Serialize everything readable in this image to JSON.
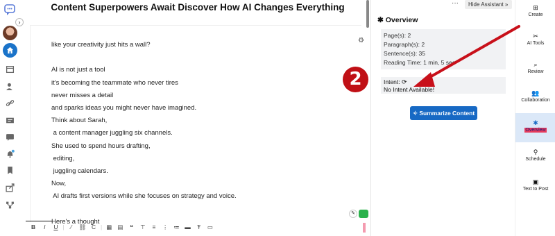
{
  "document": {
    "title": "Content Superpowers Await Discover How AI Changes Everything",
    "lines": [
      "like your creativity just hits a wall?",
      "",
      "AI is not just a tool",
      "it's becoming the teammate who never tires",
      "never misses a detail",
      "and sparks ideas you might never have imagined.",
      "Think about Sarah,",
      " a content manager juggling six channels.",
      "She used to spend hours drafting,",
      " editing,",
      " juggling calendars.",
      "Now,",
      " AI drafts first versions while she focuses on strategy and voice.",
      "",
      "Here's a thought"
    ]
  },
  "toolbar": {
    "items": [
      "B",
      "I",
      "U",
      "|",
      "⁄",
      "⛓",
      "C",
      "|",
      "▦",
      "▤",
      "❝",
      "⊤",
      "≡",
      "⋮",
      "≔",
      "▬",
      "Ŧ",
      "▭"
    ]
  },
  "assistant": {
    "more": "···",
    "hide_label": "Hide Assistant »",
    "overview_title": "Overview",
    "stats": [
      "Page(s): 2",
      "Paragraph(s): 2",
      "Sentence(s): 35",
      "Reading Time: 1 min, 5 sec"
    ],
    "intent_label": "Intent:",
    "intent_value": "No Intent Available!",
    "summarize_label": "Summarize Content"
  },
  "right_nav": {
    "items": [
      {
        "icon": "plus-square-icon",
        "glyph": "⊞",
        "label": "Create"
      },
      {
        "icon": "wand-icon",
        "glyph": "✂",
        "label": "AI Tools"
      },
      {
        "icon": "search-icon",
        "glyph": "⌕",
        "label": "Review"
      },
      {
        "icon": "people-icon",
        "glyph": "👥",
        "label": "Collaboration"
      },
      {
        "icon": "asterisk-icon",
        "glyph": "✱",
        "label": "Overview"
      },
      {
        "icon": "pin-icon",
        "glyph": "⚲",
        "label": "Schedule"
      },
      {
        "icon": "image-icon",
        "glyph": "▣",
        "label": "Text to Post"
      }
    ],
    "active": "Overview"
  },
  "annotation": {
    "step_number": "2",
    "arrow_color": "#c8101a"
  },
  "colors": {
    "primary": "#1769c4",
    "active_nav_bg": "#dbe8f8",
    "highlight": "#e73b5c"
  }
}
